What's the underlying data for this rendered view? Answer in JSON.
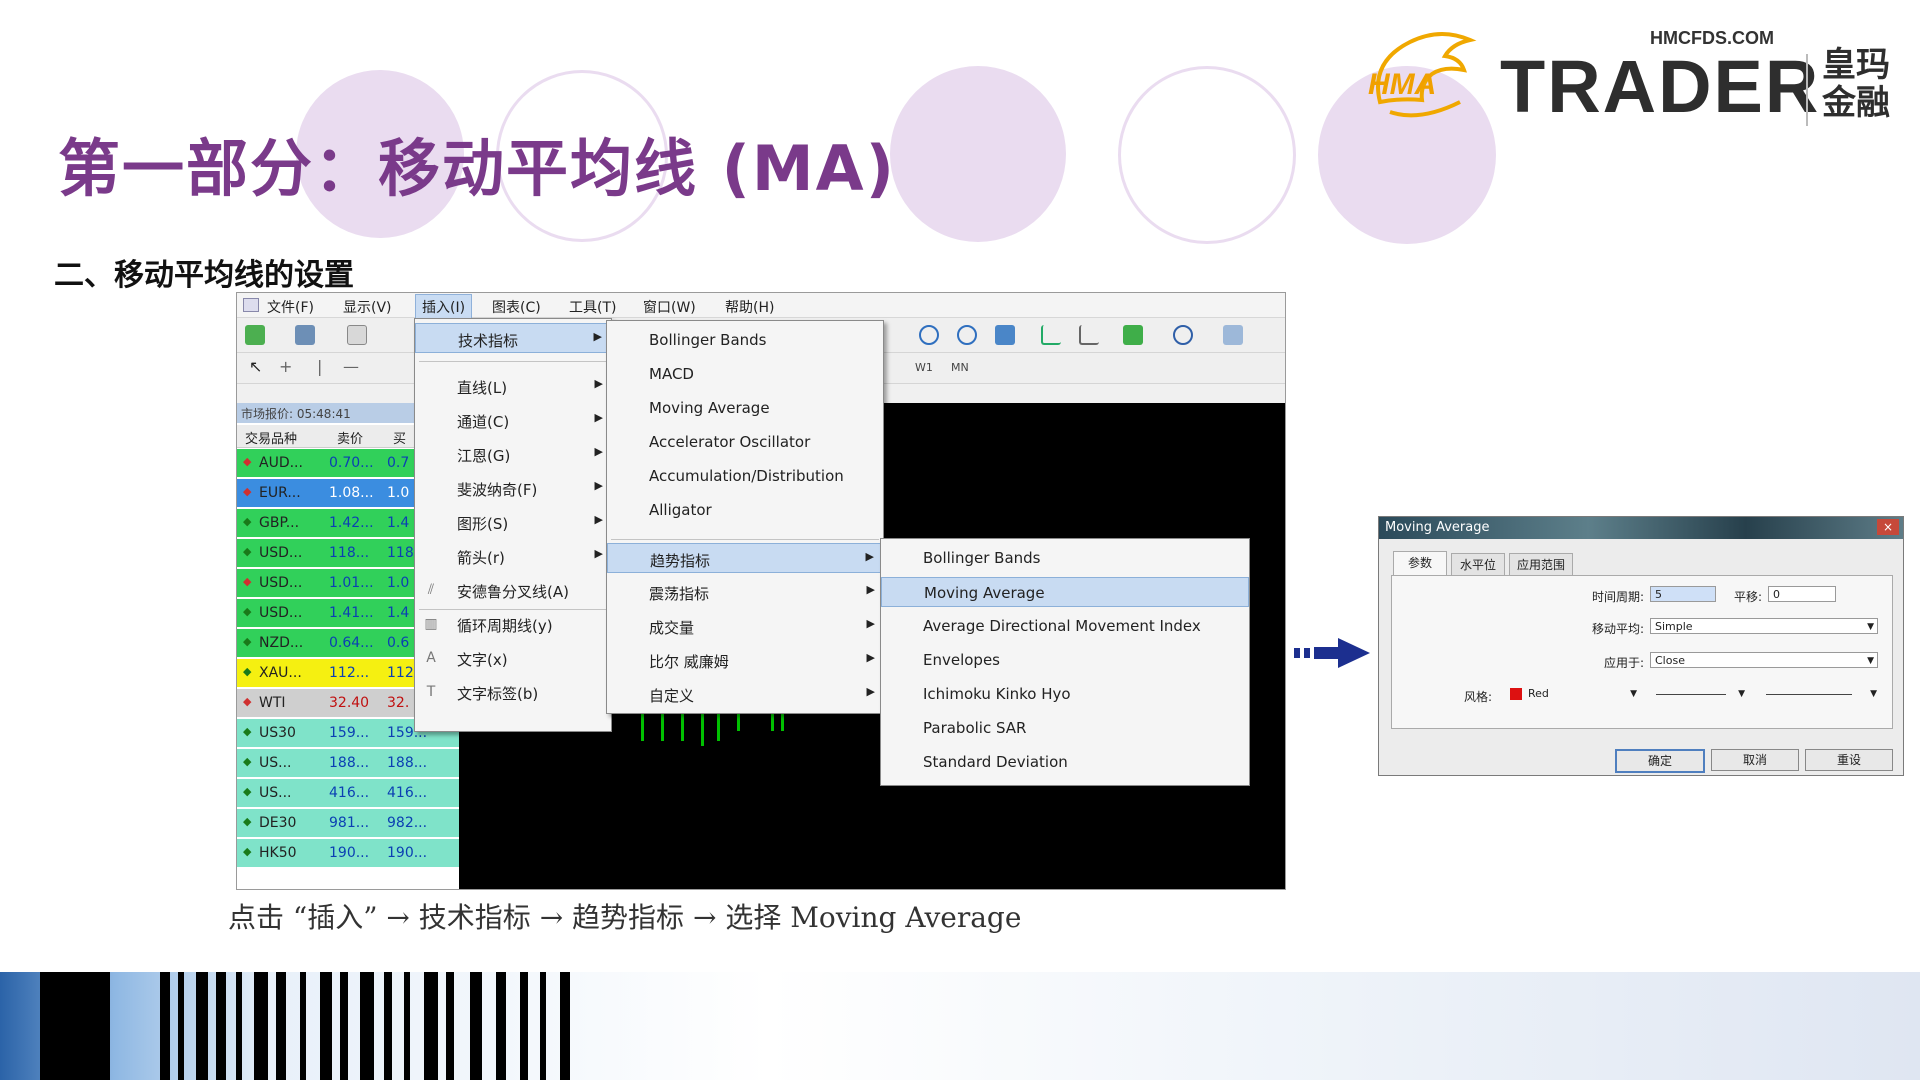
{
  "slide": {
    "title": "第一部分：移动平均线 (MA)",
    "section_title": "二、移动平均线的设置",
    "caption": "点击 “插入” → 技术指标 → 趋势指标 → 选择 Moving Average"
  },
  "logo": {
    "domain": "HMCFDS.COM",
    "brand": "TRADER",
    "mark": "HMA",
    "cn_line1": "皇玛",
    "cn_line2": "金融"
  },
  "colors": {
    "title": "#7a3a8a",
    "circle": "#e9dcef",
    "chart_bg": "#000000",
    "candle": "#00c000",
    "highlight": "#c8dbf2",
    "arrow": "#1c2f8f"
  },
  "menubar": [
    {
      "label": "文件(F)"
    },
    {
      "label": "显示(V)"
    },
    {
      "label": "插入(I)"
    },
    {
      "label": "图表(C)"
    },
    {
      "label": "工具(T)"
    },
    {
      "label": "窗口(W)"
    },
    {
      "label": "帮助(H)"
    }
  ],
  "toolbar": {
    "timeframes": [
      "W1",
      "MN"
    ]
  },
  "market_watch": {
    "time_label": "市场报价: 05:48:41",
    "headers": [
      "交易品种",
      "卖价",
      "买"
    ],
    "rows": [
      {
        "symbol": "AUD...",
        "bid": "0.70...",
        "ask": "0.7",
        "bg": "#31d05a"
      },
      {
        "symbol": "EUR...",
        "bid": "1.08...",
        "ask": "1.0",
        "bg": "#3b8de0"
      },
      {
        "symbol": "GBP...",
        "bid": "1.42...",
        "ask": "1.4",
        "bg": "#31d05a"
      },
      {
        "symbol": "USD...",
        "bid": "118...",
        "ask": "118",
        "bg": "#31d05a"
      },
      {
        "symbol": "USD...",
        "bid": "1.01...",
        "ask": "1.0",
        "bg": "#31d05a"
      },
      {
        "symbol": "USD...",
        "bid": "1.41...",
        "ask": "1.4",
        "bg": "#31d05a"
      },
      {
        "symbol": "NZD...",
        "bid": "0.64...",
        "ask": "0.6",
        "bg": "#31d05a"
      },
      {
        "symbol": "XAU...",
        "bid": "112...",
        "ask": "112",
        "bg": "#f5f011"
      },
      {
        "symbol": "WTI",
        "bid": "32.40",
        "ask": "32.",
        "bg": "#cfcfcf"
      },
      {
        "symbol": "US30",
        "bid": "159...",
        "ask": "159...",
        "bg": "#7fe3c9"
      },
      {
        "symbol": "US...",
        "bid": "188...",
        "ask": "188...",
        "bg": "#7fe3c9"
      },
      {
        "symbol": "US...",
        "bid": "416...",
        "ask": "416...",
        "bg": "#7fe3c9"
      },
      {
        "symbol": "DE30",
        "bid": "981...",
        "ask": "982...",
        "bg": "#7fe3c9"
      },
      {
        "symbol": "HK50",
        "bid": "190...",
        "ask": "190...",
        "bg": "#7fe3c9"
      }
    ]
  },
  "insert_menu": [
    {
      "label": "技术指标",
      "submenu": true,
      "icon": ""
    },
    {
      "label": "直线(L)",
      "submenu": true,
      "icon": ""
    },
    {
      "label": "通道(C)",
      "submenu": true,
      "icon": ""
    },
    {
      "label": "江恩(G)",
      "submenu": true,
      "icon": ""
    },
    {
      "label": "斐波纳奇(F)",
      "submenu": true,
      "icon": ""
    },
    {
      "label": "图形(S)",
      "submenu": true,
      "icon": ""
    },
    {
      "label": "箭头(r)",
      "submenu": true,
      "icon": ""
    },
    {
      "label": "安德鲁分叉线(A)",
      "submenu": false,
      "icon": "⫽"
    },
    {
      "label": "循环周期线(y)",
      "submenu": false,
      "icon": "▥"
    },
    {
      "label": "文字(x)",
      "submenu": false,
      "icon": "A"
    },
    {
      "label": "文字标签(b)",
      "submenu": false,
      "icon": "T"
    }
  ],
  "indicator_menu": [
    {
      "label": "Bollinger Bands",
      "submenu": false
    },
    {
      "label": "MACD",
      "submenu": false
    },
    {
      "label": "Moving Average",
      "submenu": false
    },
    {
      "label": "Accelerator Oscillator",
      "submenu": false
    },
    {
      "label": "Accumulation/Distribution",
      "submenu": false
    },
    {
      "label": "Alligator",
      "submenu": false
    },
    {
      "label": "趋势指标",
      "submenu": true
    },
    {
      "label": "震荡指标",
      "submenu": true
    },
    {
      "label": "成交量",
      "submenu": true
    },
    {
      "label": "比尔 威廉姆",
      "submenu": true
    },
    {
      "label": "自定义",
      "submenu": true
    }
  ],
  "trend_menu": [
    {
      "label": "Bollinger Bands"
    },
    {
      "label": "Moving Average"
    },
    {
      "label": "Average Directional Movement Index"
    },
    {
      "label": "Envelopes"
    },
    {
      "label": "Ichimoku Kinko Hyo"
    },
    {
      "label": "Parabolic SAR"
    },
    {
      "label": "Standard Deviation"
    }
  ],
  "dialog": {
    "title": "Moving Average",
    "close": "×",
    "tabs": [
      "参数",
      "水平位",
      "应用范围"
    ],
    "period_label": "时间周期:",
    "period_value": "5",
    "shift_label": "平移:",
    "shift_value": "0",
    "method_label": "移动平均:",
    "method_value": "Simple",
    "apply_label": "应用于:",
    "apply_value": "Close",
    "style_label": "风格:",
    "style_color_name": "Red",
    "style_color": "#dd1111",
    "ok": "确定",
    "cancel": "取消",
    "reset": "重设"
  }
}
